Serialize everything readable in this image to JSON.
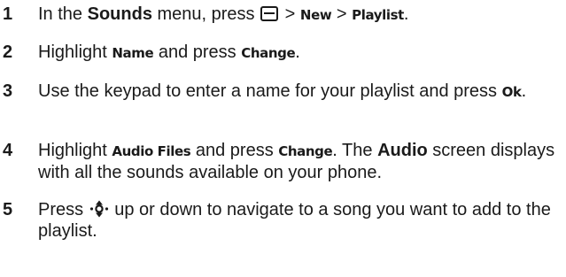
{
  "steps": [
    {
      "number": "1",
      "t1": "In the ",
      "t2": "Sounds",
      "t3": " menu, press ",
      "t4": " > ",
      "t5": "New",
      "t6": " > ",
      "t7": "Playlist",
      "t8": "."
    },
    {
      "number": "2",
      "t1": "Highlight ",
      "t2": "Name",
      "t3": " and press ",
      "t4": "Change",
      "t5": "."
    },
    {
      "number": "3",
      "t1": "Use the keypad to enter a name for your playlist and press ",
      "t2": "Ok",
      "t3": "."
    },
    {
      "number": "4",
      "t1": "Highlight ",
      "t2": "Audio Files",
      "t3": " and press ",
      "t4": "Change",
      "t5": ". The ",
      "t6": "Audio",
      "t7": " screen displays with all the sounds available on your phone."
    },
    {
      "number": "5",
      "t1": "Press ",
      "t2": " up or down to navigate to a song you want to add to the playlist."
    }
  ],
  "icons": {
    "menu_key": "menu-key-icon",
    "nav_key": "nav-key-icon"
  }
}
